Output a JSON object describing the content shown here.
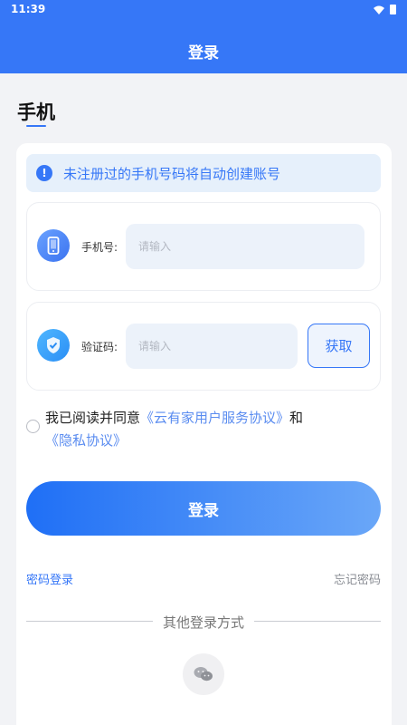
{
  "status_bar": {
    "time": "11:39"
  },
  "header": {
    "title": "登录"
  },
  "tab": {
    "title": "手机"
  },
  "notice": {
    "text": "未注册过的手机号码将自动创建账号",
    "icon": "info-icon"
  },
  "phone_field": {
    "label": "手机号:",
    "placeholder": "请输入",
    "icon": "phone-icon"
  },
  "code_field": {
    "label": "验证码:",
    "placeholder": "请输入",
    "icon": "shield-check-icon",
    "get_button": "获取"
  },
  "agreement": {
    "prefix": "我已阅读并同意",
    "service_link": "《云有家用户服务协议》",
    "connector": "和",
    "privacy_link": "《隐私协议》"
  },
  "login_button": "登录",
  "password_login": "密码登录",
  "forgot_password": "忘记密码",
  "other_methods": "其他登录方式",
  "colors": {
    "primary": "#3677f7",
    "notice_bg": "#e6f0fb",
    "background": "#f2f3f6"
  }
}
